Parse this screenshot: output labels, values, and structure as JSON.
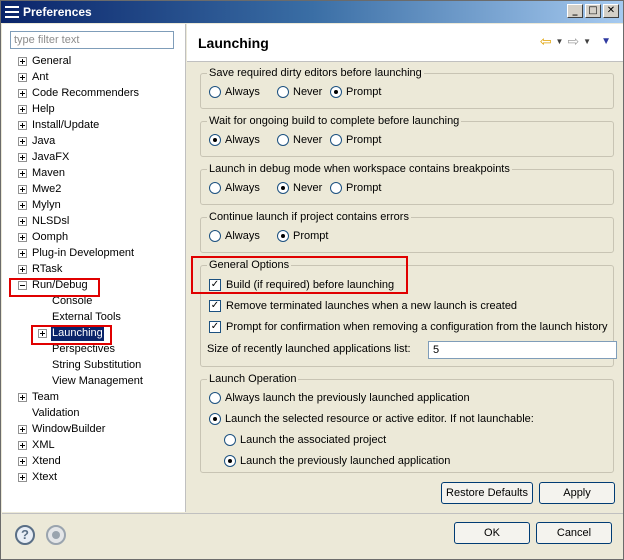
{
  "window": {
    "title": "Preferences",
    "controls": {
      "minimize": "_",
      "maximize": "□",
      "close": "✕"
    }
  },
  "filter": {
    "placeholder": "type filter text"
  },
  "tree": {
    "items": [
      {
        "label": "General",
        "expanded": false
      },
      {
        "label": "Ant",
        "expanded": false
      },
      {
        "label": "Code Recommenders",
        "expanded": false
      },
      {
        "label": "Help",
        "expanded": false
      },
      {
        "label": "Install/Update",
        "expanded": false
      },
      {
        "label": "Java",
        "expanded": false
      },
      {
        "label": "JavaFX",
        "expanded": false
      },
      {
        "label": "Maven",
        "expanded": false
      },
      {
        "label": "Mwe2",
        "expanded": false
      },
      {
        "label": "Mylyn",
        "expanded": false
      },
      {
        "label": "NLSDsl",
        "expanded": false
      },
      {
        "label": "Oomph",
        "expanded": false
      },
      {
        "label": "Plug-in Development",
        "expanded": false
      },
      {
        "label": "RTask",
        "expanded": false
      },
      {
        "label": "Run/Debug",
        "expanded": true
      },
      {
        "label": "Console",
        "child": true
      },
      {
        "label": "External Tools",
        "child": true
      },
      {
        "label": "Launching",
        "child": true,
        "selected": true,
        "expanded": false
      },
      {
        "label": "Perspectives",
        "child": true
      },
      {
        "label": "String Substitution",
        "child": true
      },
      {
        "label": "View Management",
        "child": true
      },
      {
        "label": "Team",
        "expanded": false
      },
      {
        "label": "Validation"
      },
      {
        "label": "WindowBuilder",
        "expanded": false
      },
      {
        "label": "XML",
        "expanded": false
      },
      {
        "label": "Xtend",
        "expanded": false
      },
      {
        "label": "Xtext",
        "expanded": false
      }
    ]
  },
  "page": {
    "title": "Launching",
    "nav": {
      "back_icon": "back-arrow-icon",
      "forward_icon": "forward-arrow-icon",
      "menu_icon": "view-menu-icon"
    }
  },
  "groups": {
    "save_dirty": {
      "title": "Save required dirty editors before launching",
      "options": [
        "Always",
        "Never",
        "Prompt"
      ],
      "selected": "Prompt"
    },
    "wait_build": {
      "title": "Wait for ongoing build to complete before launching",
      "options": [
        "Always",
        "Never",
        "Prompt"
      ],
      "selected": "Always"
    },
    "debug_mode": {
      "title": "Launch in debug mode when workspace contains breakpoints",
      "options": [
        "Always",
        "Never",
        "Prompt"
      ],
      "selected": "Never"
    },
    "continue_errors": {
      "title": "Continue launch if project contains errors",
      "options": [
        "Always",
        "Prompt"
      ],
      "selected": "Prompt"
    },
    "general": {
      "title": "General Options",
      "build_label": "Build (if required) before launching",
      "build_checked": true,
      "remove_label": "Remove terminated launches when a new launch is created",
      "remove_checked": true,
      "prompt_label": "Prompt for confirmation when removing a configuration from the launch history",
      "prompt_checked": true,
      "size_label": "Size of recently launched applications list:",
      "size_value": "5"
    },
    "launch_op": {
      "title": "Launch Operation",
      "opt1": "Always launch the previously launched application",
      "opt2": "Launch the selected resource or active editor. If not launchable:",
      "opt2a": "Launch the associated project",
      "opt2b": "Launch the previously launched application",
      "selected_main": "opt2",
      "selected_sub": "opt2b"
    }
  },
  "buttons": {
    "restore": "Restore Defaults",
    "apply": "Apply",
    "ok": "OK",
    "cancel": "Cancel"
  },
  "colors": {
    "highlight": "#e00000",
    "selection": "#0a246a",
    "dialog_bg": "#ece9d8"
  }
}
